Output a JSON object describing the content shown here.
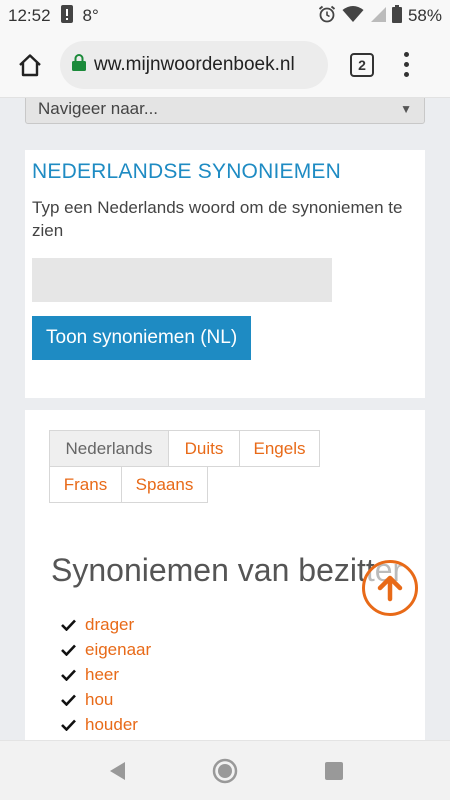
{
  "status": {
    "time": "12:52",
    "temperature": "8°",
    "battery": "58%"
  },
  "browser": {
    "url": "ww.mijnwoordenboek.nl",
    "tab_count": "2"
  },
  "nav_select": {
    "label": "Navigeer naar..."
  },
  "synonym_search": {
    "title": "NEDERLANDSE SYNONIEMEN",
    "description": "Typ een Nederlands woord om de synoniemen te zien",
    "input_value": "",
    "button_label": "Toon synoniemen (NL)"
  },
  "language_tabs": [
    {
      "label": "Nederlands",
      "active": true
    },
    {
      "label": "Duits",
      "active": false
    },
    {
      "label": "Engels",
      "active": false
    },
    {
      "label": "Frans",
      "active": false
    },
    {
      "label": "Spaans",
      "active": false
    }
  ],
  "results": {
    "heading": "Synoniemen van bezitter",
    "items": [
      "drager",
      "eigenaar",
      "heer",
      "hou",
      "houder"
    ]
  },
  "colors": {
    "accent_blue": "#1e8bc3",
    "accent_orange": "#e86a18"
  },
  "icons": {
    "home": "home-icon",
    "lock": "lock-icon",
    "menu": "more-vert-icon",
    "alarm": "alarm-icon",
    "wifi": "wifi-icon",
    "signal": "signal-icon",
    "battery": "battery-icon",
    "check": "check-icon",
    "scroll_top": "arrow-up-icon",
    "back": "back-icon",
    "home_nav": "home-circle-icon",
    "recents": "recents-icon"
  }
}
